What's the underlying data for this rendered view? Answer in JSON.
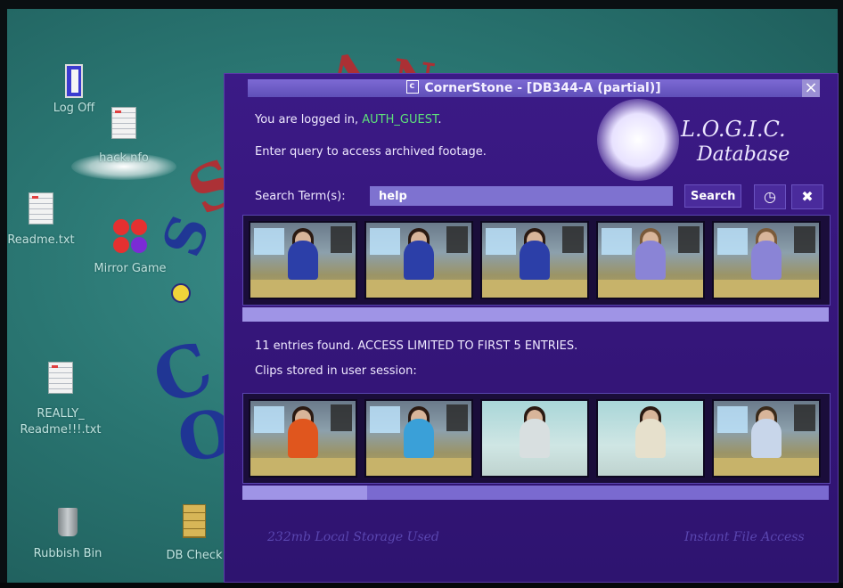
{
  "desktop": {
    "icons": [
      {
        "label": "Log Off"
      },
      {
        "label": "hack.nfo"
      },
      {
        "label": "Readme.txt"
      },
      {
        "label": "Mirror Game"
      },
      {
        "label": "REALLY_\nReadme!!!.txt"
      },
      {
        "label": "Rubbish Bin"
      },
      {
        "label": "DB Check"
      }
    ]
  },
  "window": {
    "title": "CornerStone - [DB344-A (partial)]",
    "close_glyph": "×",
    "login_prefix": "You are logged in, ",
    "username": "AUTH_GUEST",
    "login_suffix": ".",
    "query_prompt": "Enter query to access archived footage.",
    "logo_line1": "L.O.G.I.C.",
    "logo_line2": "Database",
    "search_label": "Search Term(s):",
    "search_value": "help",
    "search_button": "Search",
    "entries_text": "11 entries found. ACCESS LIMITED TO FIRST 5 ENTRIES.",
    "clips_text": "Clips stored in user session:",
    "footer_left": "232mb Local Storage Used",
    "footer_right": "Instant File Access",
    "icons": {
      "history": "clock-icon",
      "settings": "tools-icon"
    },
    "results_scroll_fraction": 1.0,
    "session_scroll_fraction": 0.21
  },
  "colors": {
    "window_bg": "#3b1a86",
    "username": "#5ee07a",
    "desktop_bg": "#2a7672"
  }
}
